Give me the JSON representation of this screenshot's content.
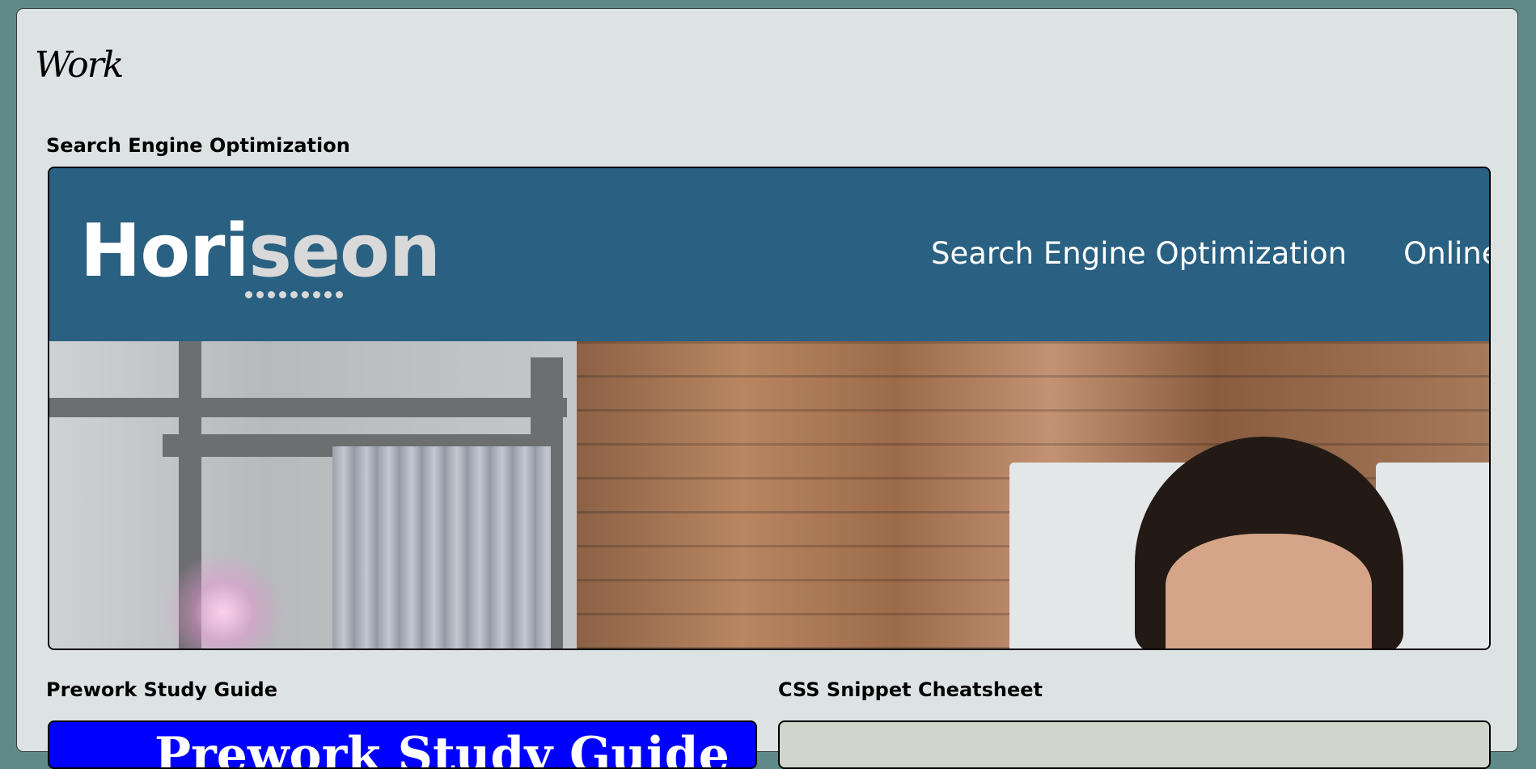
{
  "section": {
    "title": "Work"
  },
  "projects": [
    {
      "label": "Search Engine Optimization",
      "preview": {
        "brand": "Horiseon",
        "nav": [
          "Search Engine Optimization",
          "Online"
        ]
      }
    },
    {
      "label": "Prework Study Guide",
      "preview": {
        "title": "Prework Study Guide"
      }
    },
    {
      "label": "CSS Snippet Cheatsheet"
    }
  ],
  "colors": {
    "page_background": "#5f8a89",
    "panel_background": "#dde3e3",
    "horiseon_header": "#2a6081",
    "prework_background": "#0000ff",
    "css_cheatsheet_background": "#d0d6cc"
  }
}
